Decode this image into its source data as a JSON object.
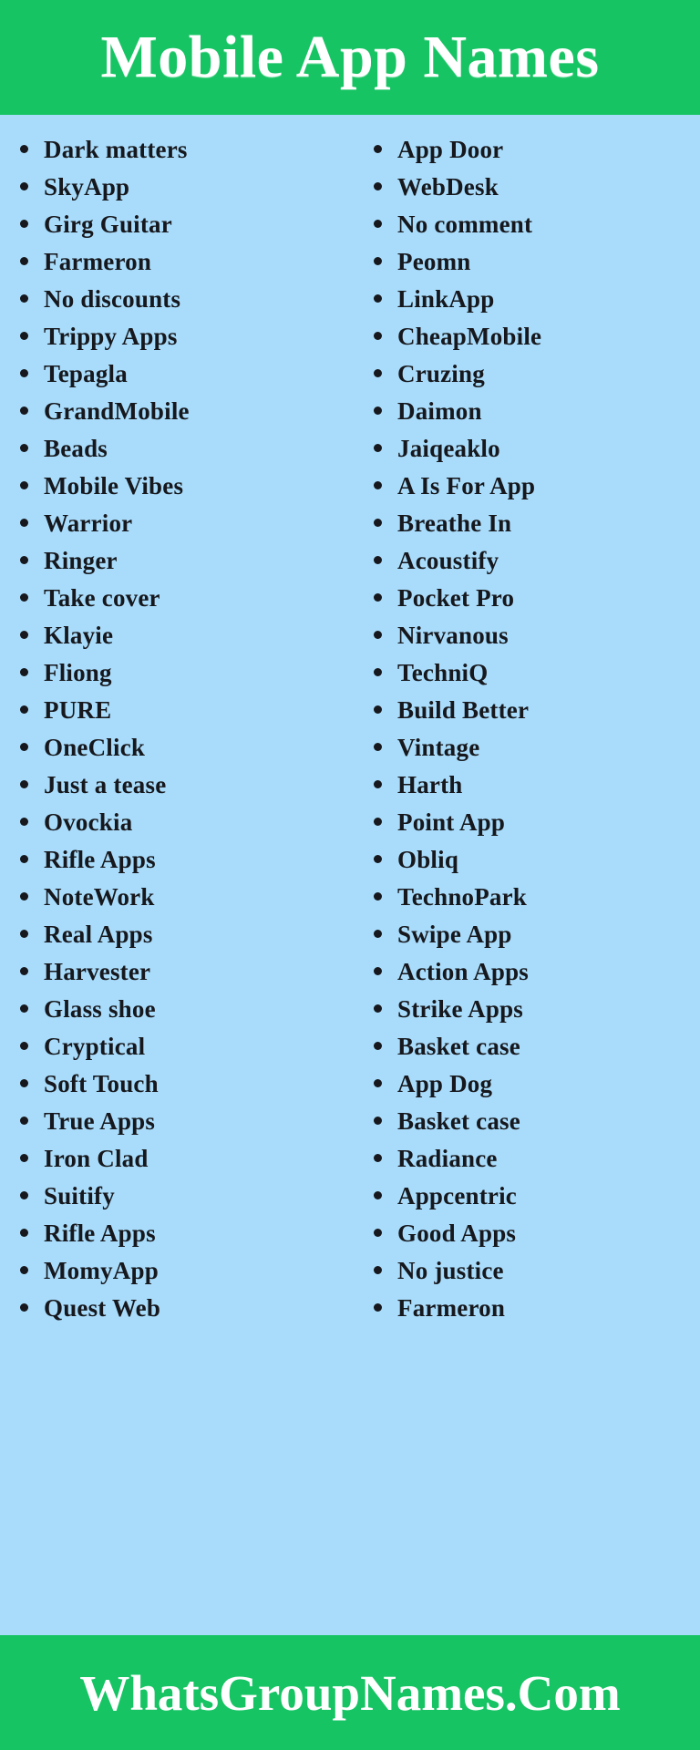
{
  "header": {
    "title": "Mobile App Names",
    "background_color": "#17c464",
    "text_color": "#ffffff"
  },
  "body": {
    "background_color": "#a9dcfb",
    "text_color": "#16181d",
    "bullet_color": "#16181d",
    "columns": [
      {
        "name": "left-column",
        "items": [
          "Dark matters",
          "SkyApp",
          "Girg Guitar",
          "Farmeron",
          "No discounts",
          "Trippy Apps",
          "Tepagla",
          "GrandMobile",
          "Beads",
          "Mobile Vibes",
          "Warrior",
          "Ringer",
          "Take cover",
          "Klayie",
          "Fliong",
          "PURE",
          "OneClick",
          "Just a tease",
          "Ovockia",
          "Rifle Apps",
          "NoteWork",
          "Real Apps",
          "Harvester",
          "Glass shoe",
          "Cryptical",
          "Soft Touch",
          "True Apps",
          "Iron Clad",
          "Suitify",
          "Rifle Apps",
          "MomyApp",
          "Quest Web"
        ]
      },
      {
        "name": "right-column",
        "items": [
          "App Door",
          "WebDesk",
          "No comment",
          "Peomn",
          "LinkApp",
          "CheapMobile",
          "Cruzing",
          "Daimon",
          "Jaiqeaklo",
          "A Is For App",
          "Breathe In",
          "Acoustify",
          "Pocket Pro",
          "Nirvanous",
          "TechniQ",
          "Build Better",
          "Vintage",
          "Harth",
          "Point App",
          "Obliq",
          "TechnoPark",
          "Swipe App",
          "Action Apps",
          "Strike Apps",
          "Basket case",
          "App Dog",
          "Basket case",
          "Radiance",
          "Appcentric",
          "Good Apps",
          "No justice",
          "Farmeron"
        ]
      }
    ]
  },
  "footer": {
    "title": "WhatsGroupNames.Com",
    "background_color": "#17c464",
    "text_color": "#ffffff"
  }
}
